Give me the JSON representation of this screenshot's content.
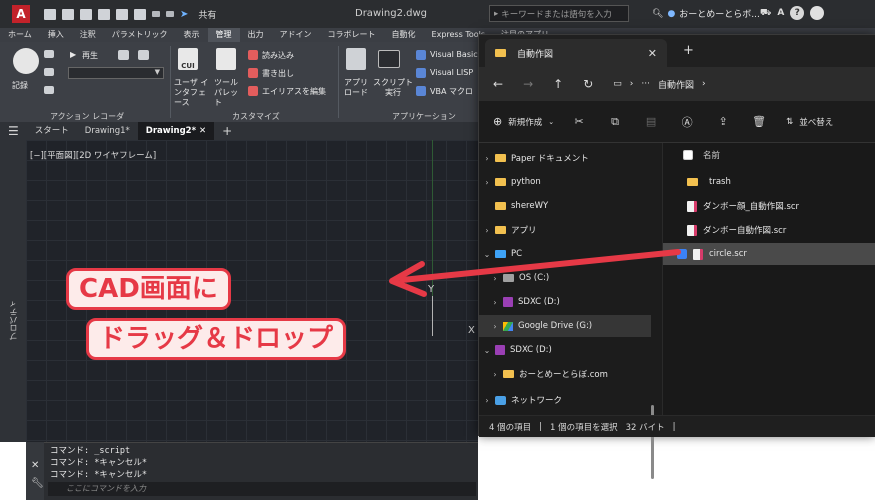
{
  "titlebar": {
    "logo": "A",
    "share_label": "共有",
    "document_title": "Drawing2.dwg",
    "search_placeholder": "キーワードまたは語句を入力",
    "user_name": "おーとめーとらボ...",
    "help_label": "?"
  },
  "ribbon_tabs": [
    "ホーム",
    "挿入",
    "注釈",
    "パラメトリック",
    "表示",
    "管理",
    "出力",
    "アドイン",
    "コラボレート",
    "自動化",
    "Express Tools",
    "注目のアプリ"
  ],
  "active_ribbon_tab": "管理",
  "ribbon": {
    "record_label": "記録",
    "play_label": "再生",
    "cui_label": "CUI",
    "user_interface_label_1": "ユーザ インタフェース",
    "tool_palette_label": "ツール パレット",
    "import_label": "読み込み",
    "export_label": "書き出し",
    "edit_alias_label": "エイリアスを編集",
    "app_load_label": "アプリ ロード",
    "script_run_label": "スクリプト 実行",
    "visual_basic_label": "Visual Basic",
    "visual_lisp_label": "Visual LISP",
    "vba_macro_label": "VBA マクロ",
    "panel_action_recorder": "アクション レコーダ",
    "panel_customize": "カスタマイズ",
    "panel_applications": "アプリケーション"
  },
  "doc_tabs": {
    "start": "スタート",
    "drawing1": "Drawing1*",
    "drawing2": "Drawing2*",
    "plus": "+"
  },
  "canvas": {
    "view_label": "[−][平面図][2D ワイヤフレーム]",
    "axis_y": "Y",
    "axis_x": "X",
    "side_label": "プロパティ"
  },
  "callout": {
    "line1": "CAD画面に",
    "line2": "ドラッグ＆ドロップ"
  },
  "command_line": {
    "lines": [
      "コマンド: _script",
      "コマンド: *キャンセル*",
      "コマンド: *キャンセル*"
    ],
    "placeholder": "ここにコマンドを入力"
  },
  "explorer": {
    "tab_title": "自動作図",
    "path_more": "···",
    "path_current": "自動作図",
    "new_label": "新規作成",
    "sort_label": "並べ替え",
    "column_name": "名前",
    "nav_items": [
      {
        "label": "Paper ドキュメント",
        "icon": "folder"
      },
      {
        "label": "python",
        "icon": "folder"
      },
      {
        "label": "shereWY",
        "icon": "folder"
      },
      {
        "label": "アプリ",
        "icon": "folder"
      },
      {
        "label": "PC",
        "icon": "pc"
      },
      {
        "label": "OS (C:)",
        "icon": "drive"
      },
      {
        "label": "SDXC (D:)",
        "icon": "sd"
      },
      {
        "label": "Google Drive (G:)",
        "icon": "gdrive"
      },
      {
        "label": "SDXC (D:)",
        "icon": "sd"
      },
      {
        "label": "おーとめーとらぼ.com",
        "icon": "folder"
      },
      {
        "label": "ネットワーク",
        "icon": "network"
      }
    ],
    "files": [
      {
        "name": "trash",
        "type": "folder"
      },
      {
        "name": "ダンボー顔_自動作図.scr",
        "type": "scr"
      },
      {
        "name": "ダンボー自動作図.scr",
        "type": "scr"
      },
      {
        "name": "circle.scr",
        "type": "scr"
      }
    ],
    "status_count": "4 個の項目",
    "status_selected": "1 個の項目を選択",
    "status_size": "32 バイト"
  },
  "colors": {
    "accent_red": "#e63946",
    "autocad_red": "#c2222a",
    "folder_yellow": "#f2c04f"
  }
}
